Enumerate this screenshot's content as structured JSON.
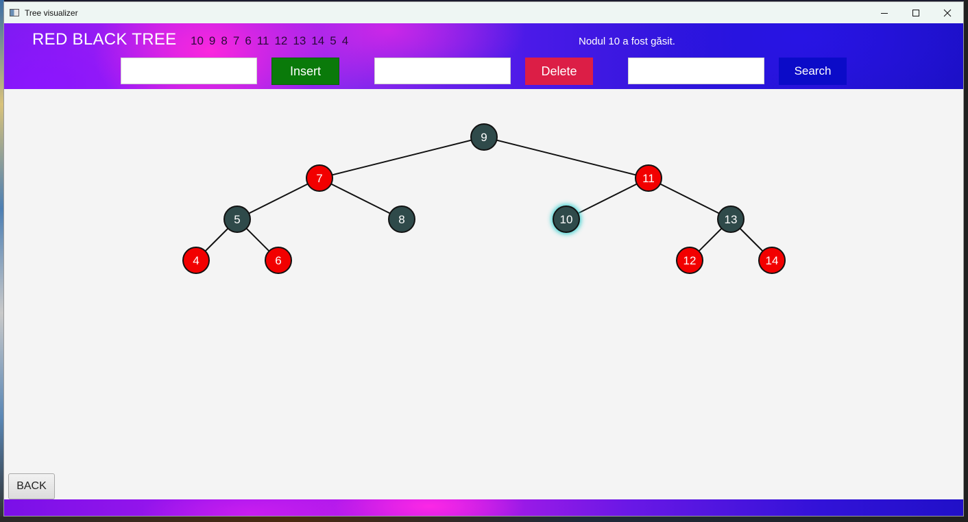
{
  "window": {
    "title": "Tree visualizer"
  },
  "header": {
    "app_title": "RED BLACK TREE",
    "sequence": [
      "10",
      "9",
      "8",
      "7",
      "6",
      "11",
      "12",
      "13",
      "14",
      "5",
      "4"
    ],
    "status_message": "Nodul 10 a fost găsit.",
    "insert_input": {
      "value": "",
      "placeholder": ""
    },
    "insert_label": "Insert",
    "delete_input": {
      "value": "",
      "placeholder": ""
    },
    "delete_label": "Delete",
    "search_input": {
      "value": "",
      "placeholder": ""
    },
    "search_label": "Search"
  },
  "footer": {
    "back_label": "BACK"
  },
  "colors": {
    "red_node": "#f20000",
    "black_node": "#2f4a4a",
    "highlight": "#3fd0d0",
    "insert_button": "#0a7a0a",
    "delete_button": "#dc1e46",
    "search_button": "#0b0bc8"
  },
  "tree": {
    "highlighted": "10",
    "nodes": [
      {
        "value": "9",
        "color": "black",
        "parent": null
      },
      {
        "value": "7",
        "color": "red",
        "parent": "9",
        "side": "left"
      },
      {
        "value": "11",
        "color": "red",
        "parent": "9",
        "side": "right"
      },
      {
        "value": "5",
        "color": "black",
        "parent": "7",
        "side": "left"
      },
      {
        "value": "8",
        "color": "black",
        "parent": "7",
        "side": "right"
      },
      {
        "value": "10",
        "color": "black",
        "parent": "11",
        "side": "left"
      },
      {
        "value": "13",
        "color": "black",
        "parent": "11",
        "side": "right"
      },
      {
        "value": "4",
        "color": "red",
        "parent": "5",
        "side": "left"
      },
      {
        "value": "6",
        "color": "red",
        "parent": "5",
        "side": "right"
      },
      {
        "value": "12",
        "color": "red",
        "parent": "13",
        "side": "left"
      },
      {
        "value": "14",
        "color": "red",
        "parent": "13",
        "side": "right"
      }
    ]
  }
}
